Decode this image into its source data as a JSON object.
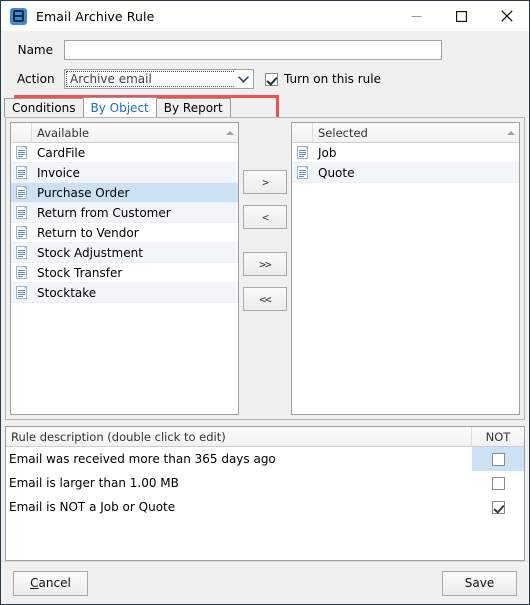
{
  "window": {
    "title": "Email Archive Rule",
    "icon": "app-email-icon",
    "minimize": "minimize-icon",
    "maximize": "maximize-icon",
    "close": "close-icon"
  },
  "form": {
    "name_label": "Name",
    "name_value": "",
    "name_placeholder": "",
    "action_label": "Action",
    "action_value": "Archive email",
    "action_options": [
      "Archive email"
    ],
    "turn_on_label": "Turn on this rule",
    "turn_on_checked": true,
    "highlight_color": "#f0514e"
  },
  "tabs": [
    {
      "label": "Conditions",
      "active": false
    },
    {
      "label": "By Object",
      "active": true
    },
    {
      "label": "By Report",
      "active": false
    }
  ],
  "available_list": {
    "header": "Available",
    "sort": "ascending",
    "items": [
      {
        "label": "CardFile",
        "selected": false
      },
      {
        "label": "Invoice",
        "selected": false
      },
      {
        "label": "Purchase Order",
        "selected": true
      },
      {
        "label": "Return from Customer",
        "selected": false
      },
      {
        "label": "Return to Vendor",
        "selected": false
      },
      {
        "label": "Stock Adjustment",
        "selected": false
      },
      {
        "label": "Stock Transfer",
        "selected": false
      },
      {
        "label": "Stocktake",
        "selected": false
      }
    ]
  },
  "selected_list": {
    "header": "Selected",
    "sort": "ascending",
    "items": [
      {
        "label": "Job",
        "selected": false
      },
      {
        "label": "Quote",
        "selected": false
      }
    ]
  },
  "transfer_buttons": [
    {
      "label": ">",
      "name": "move-right-button"
    },
    {
      "label": "<",
      "name": "move-left-button"
    },
    {
      "label": ">>",
      "name": "move-all-right-button"
    },
    {
      "label": "<<",
      "name": "move-all-left-button"
    }
  ],
  "rule_description": {
    "header": "Rule description (double click to edit)",
    "not_header": "NOT",
    "rows": [
      {
        "text": "Email was received more than 365 days ago",
        "not_checked": false,
        "row_selected": true
      },
      {
        "text": "Email is larger than 1.00 MB",
        "not_checked": false,
        "row_selected": false
      },
      {
        "text": "Email is NOT a Job or Quote",
        "not_checked": true,
        "row_selected": false
      }
    ]
  },
  "footer": {
    "cancel_accel": "C",
    "cancel_rest": "ancel",
    "save_label": "Save"
  }
}
